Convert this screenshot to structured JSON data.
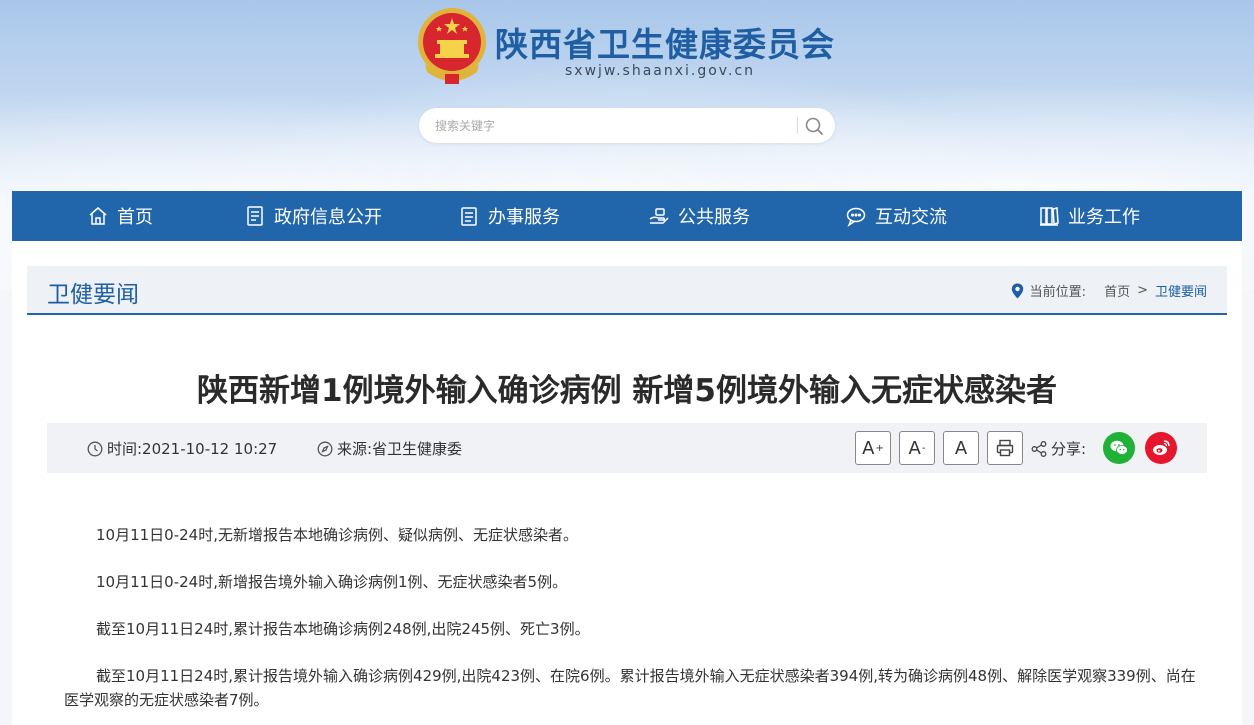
{
  "header": {
    "site_name": "陕西省卫生健康委员会",
    "domain": "sxwjw.shaanxi.gov.cn",
    "search_placeholder": "搜索关键字"
  },
  "nav": {
    "items": [
      {
        "label": "首页",
        "icon": "home-icon"
      },
      {
        "label": "政府信息公开",
        "icon": "document-icon"
      },
      {
        "label": "办事服务",
        "icon": "clipboard-icon"
      },
      {
        "label": "公共服务",
        "icon": "hand-service-icon"
      },
      {
        "label": "互动交流",
        "icon": "chat-icon"
      },
      {
        "label": "业务工作",
        "icon": "books-icon"
      }
    ]
  },
  "section": {
    "title": "卫健要闻",
    "breadcrumb_label": "当前位置:",
    "breadcrumb_home": "首页",
    "breadcrumb_sep": ">",
    "breadcrumb_current": "卫健要闻"
  },
  "article": {
    "title": "陕西新增1例境外输入确诊病例 新增5例境外输入无症状感染者",
    "time": "时间:2021-10-12 10:27",
    "source": "来源:省卫生健康委",
    "font_larger": "A",
    "font_larger_sup": "+",
    "font_smaller": "A",
    "font_smaller_sup": "-",
    "font_default": "A",
    "share_label": "分享:",
    "paragraphs": [
      "10月11日0-24时,无新增报告本地确诊病例、疑似病例、无症状感染者。",
      "10月11日0-24时,新增报告境外输入确诊病例1例、无症状感染者5例。",
      "截至10月11日24时,累计报告本地确诊病例248例,出院245例、死亡3例。",
      "截至10月11日24时,累计报告境外输入确诊病例429例,出院423例、在院6例。累计报告境外输入无症状感染者394例,转为确诊病例48例、解除医学观察339例、尚在医学观察的无症状感染者7例。"
    ]
  },
  "colors": {
    "nav_bg": "#2166aa",
    "brand_text": "#1f5ea3",
    "wechat": "#21b138",
    "weibo": "#e6162d"
  }
}
